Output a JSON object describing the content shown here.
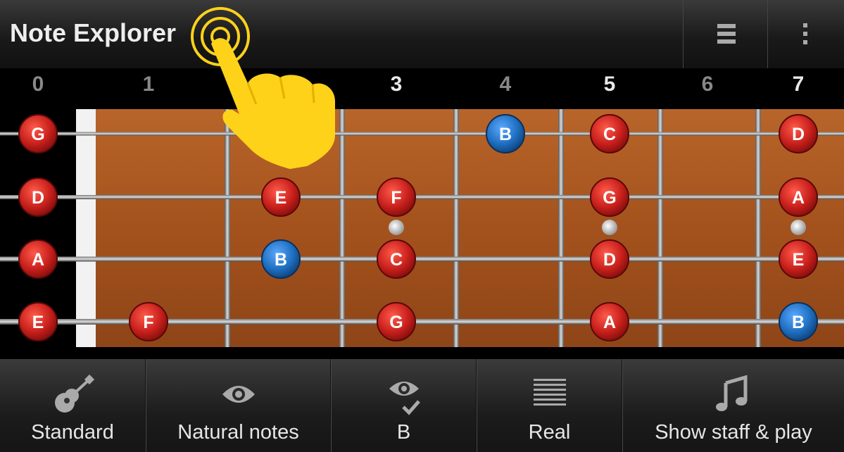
{
  "app": {
    "title": "Note Explorer"
  },
  "toolbar": {
    "list_icon": "list-icon",
    "overflow_icon": "overflow-menu-icon"
  },
  "hint": {
    "icon": "tap-hand-icon"
  },
  "frets": [
    {
      "label": "0",
      "bright": false
    },
    {
      "label": "1",
      "bright": false
    },
    {
      "label": "3",
      "bright": true
    },
    {
      "label": "4",
      "bright": false
    },
    {
      "label": "5",
      "bright": true
    },
    {
      "label": "6",
      "bright": false
    },
    {
      "label": "7",
      "bright": true
    }
  ],
  "strings": [
    {
      "open": "G",
      "notes": [
        {
          "fret": 4,
          "note": "B",
          "color": "blue"
        },
        {
          "fret": 5,
          "note": "C",
          "color": "red"
        },
        {
          "fret": 7,
          "note": "D",
          "color": "red"
        }
      ]
    },
    {
      "open": "D",
      "notes": [
        {
          "fret": 2,
          "note": "E",
          "color": "red"
        },
        {
          "fret": 3,
          "note": "F",
          "color": "red"
        },
        {
          "fret": 5,
          "note": "G",
          "color": "red"
        },
        {
          "fret": 7,
          "note": "A",
          "color": "red"
        }
      ]
    },
    {
      "open": "A",
      "notes": [
        {
          "fret": 2,
          "note": "B",
          "color": "blue"
        },
        {
          "fret": 3,
          "note": "C",
          "color": "red"
        },
        {
          "fret": 5,
          "note": "D",
          "color": "red"
        },
        {
          "fret": 7,
          "note": "E",
          "color": "red"
        }
      ]
    },
    {
      "open": "E",
      "notes": [
        {
          "fret": 1,
          "note": "F",
          "color": "red"
        },
        {
          "fret": 3,
          "note": "G",
          "color": "red"
        },
        {
          "fret": 5,
          "note": "A",
          "color": "red"
        },
        {
          "fret": 7,
          "note": "B",
          "color": "blue"
        }
      ]
    }
  ],
  "bottom": [
    {
      "label": "Standard",
      "icon": "guitar-icon"
    },
    {
      "label": "Natural notes",
      "icon": "eye-icon"
    },
    {
      "label": "B",
      "icon": "eye-check-icon"
    },
    {
      "label": "Real",
      "icon": "staff-lines-icon"
    },
    {
      "label": "Show staff & play",
      "icon": "music-note-icon"
    }
  ],
  "colors": {
    "red": "#c8201c",
    "blue": "#1f6fc0",
    "fretboard": "#a9561f"
  }
}
